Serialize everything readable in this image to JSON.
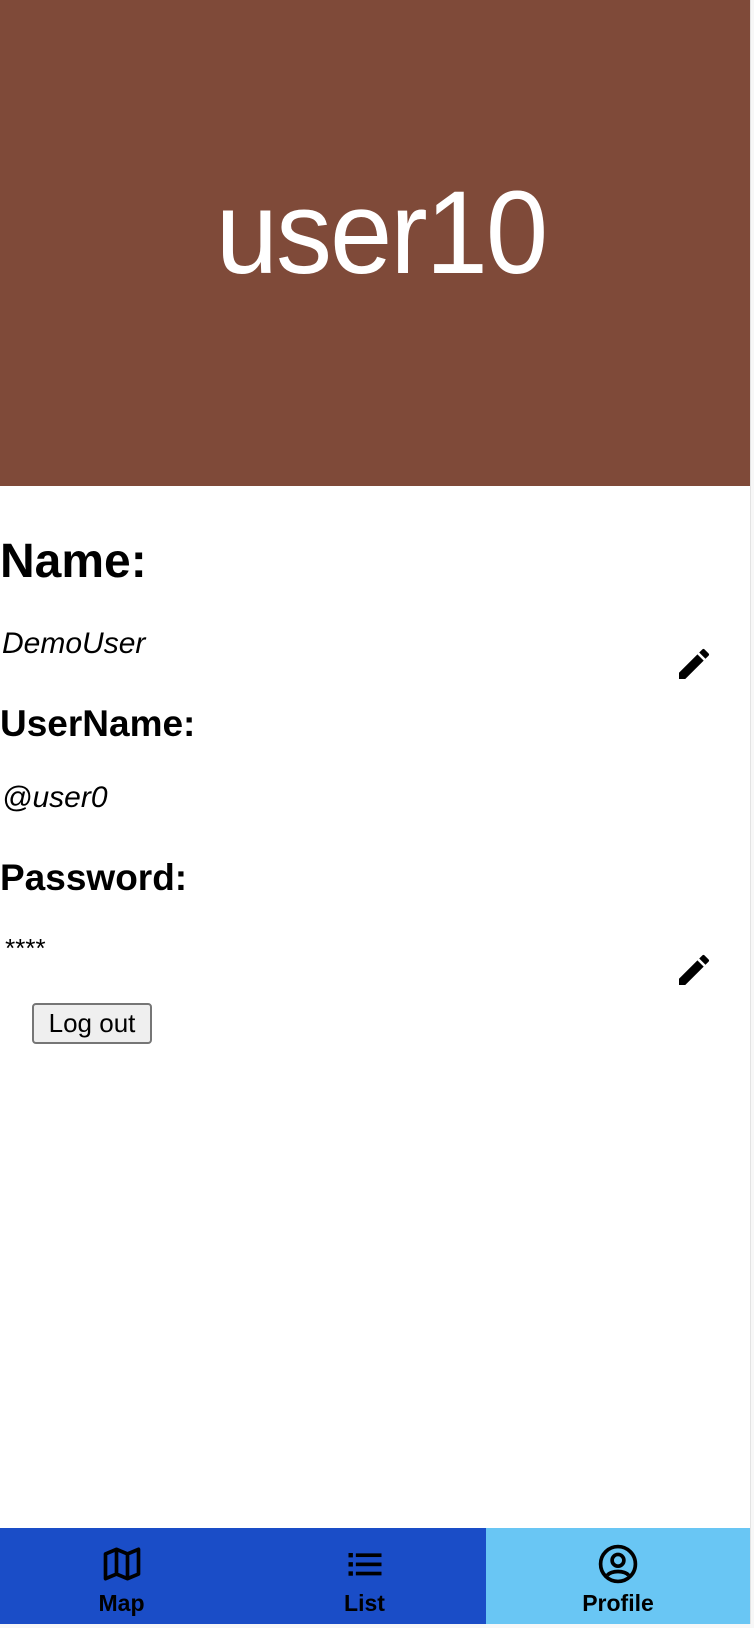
{
  "banner": {
    "username": "user10",
    "background": "#7f4a39"
  },
  "profile": {
    "name_label": "Name:",
    "name_value": "DemoUser",
    "username_label": "UserName:",
    "username_value": "@user0",
    "password_label": "Password:",
    "password_value": "****",
    "logout_label": "Log out"
  },
  "tabs": [
    {
      "label": "Map",
      "icon": "map-icon"
    },
    {
      "label": "List",
      "icon": "list-icon"
    },
    {
      "label": "Profile",
      "icon": "profile-icon",
      "active": true
    }
  ],
  "colors": {
    "tabbar": "#1a4dc7",
    "tab_active": "#69c6f4"
  }
}
